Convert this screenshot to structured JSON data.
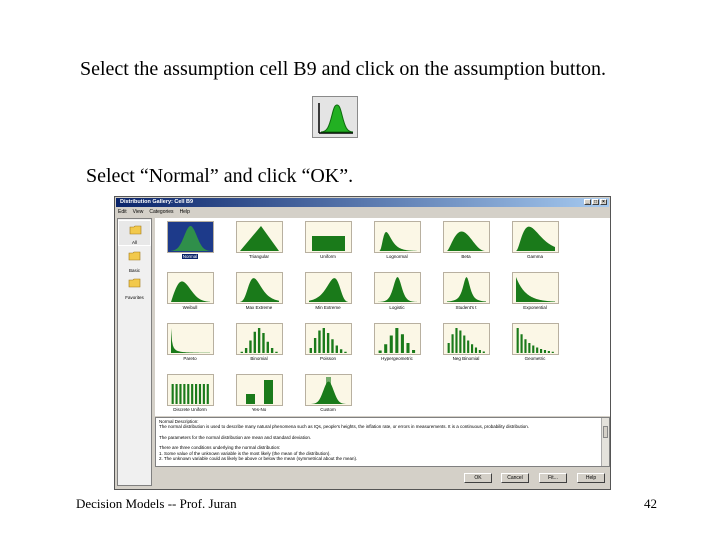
{
  "slide": {
    "instruction1": "Select the assumption cell B9 and click on the assumption button.",
    "instruction2": "Select “Normal” and click “OK”.",
    "footer_left": "Decision Models  --  Prof. Juran",
    "page_number": "42"
  },
  "assumption_button_icon": "normal-distribution-icon",
  "dialog": {
    "title": "Distribution Gallery: Cell B9",
    "menu": [
      "Edit",
      "View",
      "Categories",
      "Help"
    ],
    "sidebar": [
      {
        "label": "All",
        "icon": "folder-icon"
      },
      {
        "label": "Basic",
        "icon": "folder-icon"
      },
      {
        "label": "Favorites",
        "icon": "folder-icon"
      }
    ],
    "distributions": [
      {
        "name": "Normal",
        "shape": "normal",
        "selected": true
      },
      {
        "name": "Triangular",
        "shape": "triangular"
      },
      {
        "name": "Uniform",
        "shape": "uniform"
      },
      {
        "name": "Lognormal",
        "shape": "lognormal"
      },
      {
        "name": "Beta",
        "shape": "beta"
      },
      {
        "name": "Gamma",
        "shape": "gamma"
      },
      {
        "name": "Weibull",
        "shape": "weibull"
      },
      {
        "name": "Max Extreme",
        "shape": "maxext"
      },
      {
        "name": "Min Extreme",
        "shape": "minext"
      },
      {
        "name": "Logistic",
        "shape": "logistic"
      },
      {
        "name": "Student's t",
        "shape": "student"
      },
      {
        "name": "Exponential",
        "shape": "exponential"
      },
      {
        "name": "Pareto",
        "shape": "pareto"
      },
      {
        "name": "Binomial",
        "shape": "binomial"
      },
      {
        "name": "Poisson",
        "shape": "poisson"
      },
      {
        "name": "Hypergeometric",
        "shape": "hypergeo"
      },
      {
        "name": "Neg Binomial",
        "shape": "negbin"
      },
      {
        "name": "Geometric",
        "shape": "geometric"
      },
      {
        "name": "Discrete Uniform",
        "shape": "discuniform"
      },
      {
        "name": "Yes-No",
        "shape": "yesno"
      },
      {
        "name": "Custom",
        "shape": "custom"
      }
    ],
    "description": [
      "Normal Description:",
      "The normal distribution is used to describe many natural phenomena such as IQs, people's heights, the inflation rate, or errors in measurements. It is a continuous, probability distribution.",
      "",
      "The parameters for the normal distribution are mean and standard deviation.",
      "",
      "There are three conditions underlying the normal distribution:",
      "  1. Some value of the unknown variable is the most likely (the mean of the distribution).",
      "  2. The unknown variable could as likely be above or below the mean (symmetrical about the mean)."
    ],
    "buttons": [
      "OK",
      "Cancel",
      "Fit...",
      "Help"
    ],
    "accent_color": "#1a7a1a"
  }
}
